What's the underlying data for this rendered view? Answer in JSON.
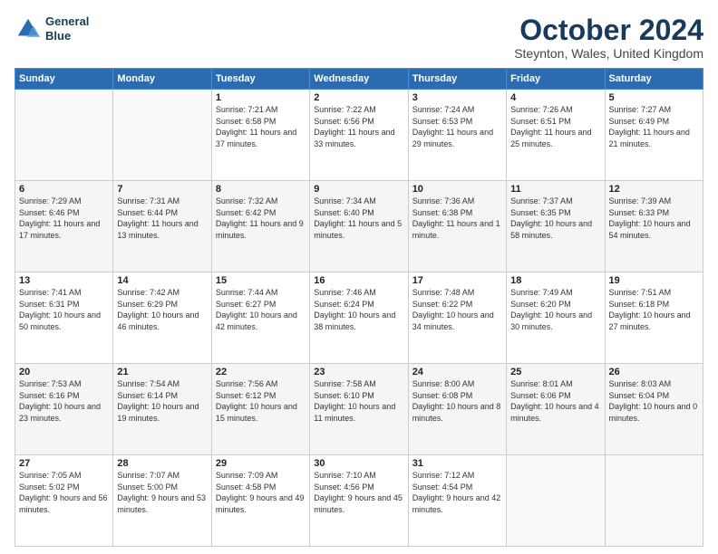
{
  "logo": {
    "line1": "General",
    "line2": "Blue"
  },
  "title": "October 2024",
  "subtitle": "Steynton, Wales, United Kingdom",
  "days_header": [
    "Sunday",
    "Monday",
    "Tuesday",
    "Wednesday",
    "Thursday",
    "Friday",
    "Saturday"
  ],
  "weeks": [
    [
      {
        "day": "",
        "info": ""
      },
      {
        "day": "",
        "info": ""
      },
      {
        "day": "1",
        "info": "Sunrise: 7:21 AM\nSunset: 6:58 PM\nDaylight: 11 hours and 37 minutes."
      },
      {
        "day": "2",
        "info": "Sunrise: 7:22 AM\nSunset: 6:56 PM\nDaylight: 11 hours and 33 minutes."
      },
      {
        "day": "3",
        "info": "Sunrise: 7:24 AM\nSunset: 6:53 PM\nDaylight: 11 hours and 29 minutes."
      },
      {
        "day": "4",
        "info": "Sunrise: 7:26 AM\nSunset: 6:51 PM\nDaylight: 11 hours and 25 minutes."
      },
      {
        "day": "5",
        "info": "Sunrise: 7:27 AM\nSunset: 6:49 PM\nDaylight: 11 hours and 21 minutes."
      }
    ],
    [
      {
        "day": "6",
        "info": "Sunrise: 7:29 AM\nSunset: 6:46 PM\nDaylight: 11 hours and 17 minutes."
      },
      {
        "day": "7",
        "info": "Sunrise: 7:31 AM\nSunset: 6:44 PM\nDaylight: 11 hours and 13 minutes."
      },
      {
        "day": "8",
        "info": "Sunrise: 7:32 AM\nSunset: 6:42 PM\nDaylight: 11 hours and 9 minutes."
      },
      {
        "day": "9",
        "info": "Sunrise: 7:34 AM\nSunset: 6:40 PM\nDaylight: 11 hours and 5 minutes."
      },
      {
        "day": "10",
        "info": "Sunrise: 7:36 AM\nSunset: 6:38 PM\nDaylight: 11 hours and 1 minute."
      },
      {
        "day": "11",
        "info": "Sunrise: 7:37 AM\nSunset: 6:35 PM\nDaylight: 10 hours and 58 minutes."
      },
      {
        "day": "12",
        "info": "Sunrise: 7:39 AM\nSunset: 6:33 PM\nDaylight: 10 hours and 54 minutes."
      }
    ],
    [
      {
        "day": "13",
        "info": "Sunrise: 7:41 AM\nSunset: 6:31 PM\nDaylight: 10 hours and 50 minutes."
      },
      {
        "day": "14",
        "info": "Sunrise: 7:42 AM\nSunset: 6:29 PM\nDaylight: 10 hours and 46 minutes."
      },
      {
        "day": "15",
        "info": "Sunrise: 7:44 AM\nSunset: 6:27 PM\nDaylight: 10 hours and 42 minutes."
      },
      {
        "day": "16",
        "info": "Sunrise: 7:46 AM\nSunset: 6:24 PM\nDaylight: 10 hours and 38 minutes."
      },
      {
        "day": "17",
        "info": "Sunrise: 7:48 AM\nSunset: 6:22 PM\nDaylight: 10 hours and 34 minutes."
      },
      {
        "day": "18",
        "info": "Sunrise: 7:49 AM\nSunset: 6:20 PM\nDaylight: 10 hours and 30 minutes."
      },
      {
        "day": "19",
        "info": "Sunrise: 7:51 AM\nSunset: 6:18 PM\nDaylight: 10 hours and 27 minutes."
      }
    ],
    [
      {
        "day": "20",
        "info": "Sunrise: 7:53 AM\nSunset: 6:16 PM\nDaylight: 10 hours and 23 minutes."
      },
      {
        "day": "21",
        "info": "Sunrise: 7:54 AM\nSunset: 6:14 PM\nDaylight: 10 hours and 19 minutes."
      },
      {
        "day": "22",
        "info": "Sunrise: 7:56 AM\nSunset: 6:12 PM\nDaylight: 10 hours and 15 minutes."
      },
      {
        "day": "23",
        "info": "Sunrise: 7:58 AM\nSunset: 6:10 PM\nDaylight: 10 hours and 11 minutes."
      },
      {
        "day": "24",
        "info": "Sunrise: 8:00 AM\nSunset: 6:08 PM\nDaylight: 10 hours and 8 minutes."
      },
      {
        "day": "25",
        "info": "Sunrise: 8:01 AM\nSunset: 6:06 PM\nDaylight: 10 hours and 4 minutes."
      },
      {
        "day": "26",
        "info": "Sunrise: 8:03 AM\nSunset: 6:04 PM\nDaylight: 10 hours and 0 minutes."
      }
    ],
    [
      {
        "day": "27",
        "info": "Sunrise: 7:05 AM\nSunset: 5:02 PM\nDaylight: 9 hours and 56 minutes."
      },
      {
        "day": "28",
        "info": "Sunrise: 7:07 AM\nSunset: 5:00 PM\nDaylight: 9 hours and 53 minutes."
      },
      {
        "day": "29",
        "info": "Sunrise: 7:09 AM\nSunset: 4:58 PM\nDaylight: 9 hours and 49 minutes."
      },
      {
        "day": "30",
        "info": "Sunrise: 7:10 AM\nSunset: 4:56 PM\nDaylight: 9 hours and 45 minutes."
      },
      {
        "day": "31",
        "info": "Sunrise: 7:12 AM\nSunset: 4:54 PM\nDaylight: 9 hours and 42 minutes."
      },
      {
        "day": "",
        "info": ""
      },
      {
        "day": "",
        "info": ""
      }
    ]
  ]
}
